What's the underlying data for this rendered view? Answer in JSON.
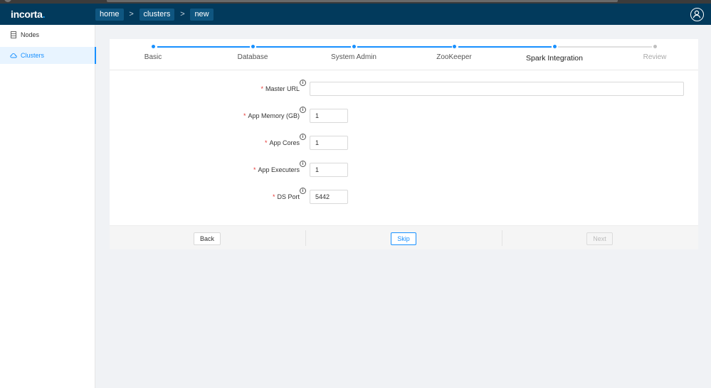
{
  "app": {
    "logo_text": "incorta",
    "logo_dot": "."
  },
  "breadcrumbs": [
    {
      "label": "home"
    },
    {
      "label": "clusters"
    },
    {
      "label": "new"
    }
  ],
  "breadcrumb_separator": ">",
  "sidebar": {
    "items": [
      {
        "label": "Nodes",
        "icon": "server-icon",
        "active": false
      },
      {
        "label": "Clusters",
        "icon": "cloud-icon",
        "active": true
      }
    ]
  },
  "wizard": {
    "steps": [
      {
        "label": "Basic",
        "status": "done"
      },
      {
        "label": "Database",
        "status": "done"
      },
      {
        "label": "System Admin",
        "status": "done"
      },
      {
        "label": "ZooKeeper",
        "status": "done"
      },
      {
        "label": "Spark Integration",
        "status": "current"
      },
      {
        "label": "Review",
        "status": "pending"
      }
    ]
  },
  "form": {
    "required_marker": "*",
    "info_glyph": "i",
    "fields": [
      {
        "label": "Master URL",
        "value": ""
      },
      {
        "label": "App Memory (GB)",
        "value": "1"
      },
      {
        "label": "App Cores",
        "value": "1"
      },
      {
        "label": "App Executers",
        "value": "1"
      },
      {
        "label": "DS Port",
        "value": "5442"
      }
    ]
  },
  "footer": {
    "back_label": "Back",
    "skip_label": "Skip",
    "next_label": "Next"
  },
  "colors": {
    "header_bg": "#023a5c",
    "accent": "#1890ff",
    "required": "#e53935"
  }
}
